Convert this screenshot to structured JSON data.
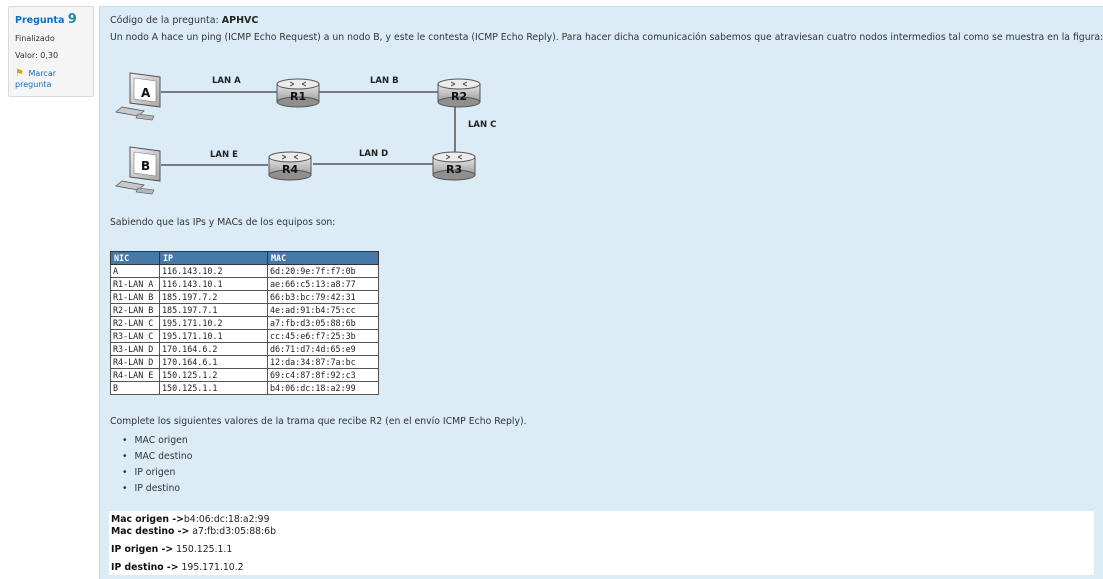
{
  "question_info": {
    "label": "Pregunta",
    "number": "9",
    "state": "Finalizado",
    "grade": "Valor: 0,30",
    "flag_label_1": "Marcar",
    "flag_label_2": "pregunta",
    "flag_icon": "flag-icon"
  },
  "question": {
    "code_label": "Código de la pregunta: ",
    "code_value": "APHVC",
    "intro": "Un nodo A hace un ping (ICMP Echo Request) a un nodo B, y este le contesta (ICMP Echo Reply). Para hacer dicha comunicación sabemos que atraviesan cuatro nodos intermedios tal como se muestra en la figura:",
    "knowing": "Sabiendo que las IPs y MACs de los equipos son:",
    "complete": "Complete los siguientes valores de la trama que recibe R2 (en el envío ICMP Echo Reply).",
    "fields": [
      "MAC origen",
      "MAC destino",
      "IP origen",
      "IP destino"
    ]
  },
  "diagram": {
    "hosts": [
      "A",
      "B"
    ],
    "routers": [
      "R1",
      "R2",
      "R3",
      "R4"
    ],
    "links": [
      "LAN A",
      "LAN B",
      "LAN C",
      "LAN D",
      "LAN E"
    ]
  },
  "table": {
    "headers": [
      "NIC",
      "IP",
      "MAC"
    ],
    "rows": [
      [
        "A",
        "116.143.10.2",
        "6d:20:9e:7f:f7:0b"
      ],
      [
        "R1-LAN A",
        "116.143.10.1",
        "ae:66:c5:13:a8:77"
      ],
      [
        "R1-LAN B",
        "185.197.7.2",
        "66:b3:bc:79:42:31"
      ],
      [
        "R2-LAN B",
        "185.197.7.1",
        "4e:ad:91:b4:75:cc"
      ],
      [
        "R2-LAN C",
        "195.171.10.2",
        "a7:fb:d3:05:88:6b"
      ],
      [
        "R3-LAN C",
        "195.171.10.1",
        "cc:45:e6:f7:25:3b"
      ],
      [
        "R3-LAN D",
        "170.164.6.2",
        "d6:71:d7:4d:65:e9"
      ],
      [
        "R4-LAN D",
        "170.164.6.1",
        "12:da:34:87:7a:bc"
      ],
      [
        "R4-LAN E",
        "150.125.1.2",
        "69:c4:87:8f:92:c3"
      ],
      [
        "B",
        "150.125.1.1",
        "b4:06:dc:18:a2:99"
      ]
    ]
  },
  "answer": {
    "mac_origen_label": "Mac origen ->",
    "mac_origen_value": "b4:06:dc:18:a2:99",
    "mac_destino_label": "Mac destino ->",
    "mac_destino_value": " a7:fb:d3:05:88:6b",
    "ip_origen_label": "IP origen ->",
    "ip_origen_value": " 150.125.1.1",
    "ip_destino_label": "IP destino ->",
    "ip_destino_value": " 195.171.10.2"
  }
}
